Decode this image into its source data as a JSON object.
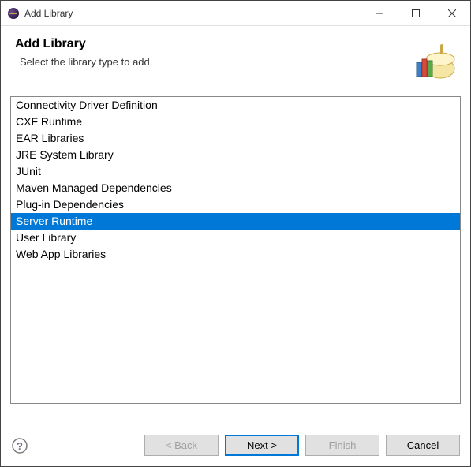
{
  "titlebar": {
    "title": "Add Library"
  },
  "header": {
    "title": "Add Library",
    "subtitle": "Select the library type to add."
  },
  "list": {
    "items": [
      "Connectivity Driver Definition",
      "CXF Runtime",
      "EAR Libraries",
      "JRE System Library",
      "JUnit",
      "Maven Managed Dependencies",
      "Plug-in Dependencies",
      "Server Runtime",
      "User Library",
      "Web App Libraries"
    ],
    "selected_index": 7
  },
  "buttons": {
    "back": "< Back",
    "next": "Next >",
    "finish": "Finish",
    "cancel": "Cancel"
  }
}
